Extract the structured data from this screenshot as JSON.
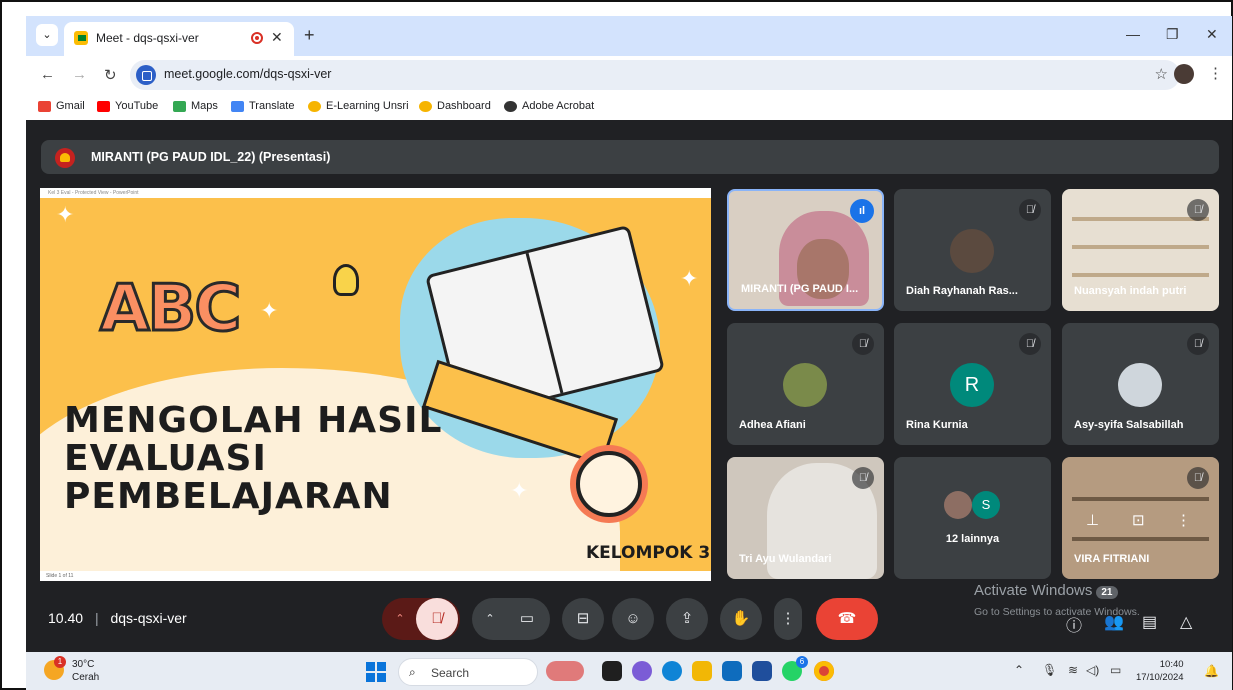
{
  "browser": {
    "tab_title": "Meet - dqs-qsxi-ver",
    "tab_close": "✕",
    "new_tab": "+",
    "url": "meet.google.com/dqs-qsxi-ver",
    "bookmarks": [
      {
        "label": "Gmail",
        "color": "#ea4335"
      },
      {
        "label": "YouTube",
        "color": "#ff0000"
      },
      {
        "label": "Maps",
        "color": "#34a853"
      },
      {
        "label": "Translate",
        "color": "#4285f4"
      },
      {
        "label": "E-Learning Unsri",
        "color": "#f6b400"
      },
      {
        "label": "Dashboard",
        "color": "#f6b400"
      },
      {
        "label": "Adobe Acrobat",
        "color": "#333333"
      }
    ]
  },
  "meet": {
    "presenter_label": "MIRANTI (PG PAUD IDL_22) (Presentasi)",
    "slide": {
      "window_title": "Kel 3 Eval  -  Protected View  -  PowerPoint",
      "logo_text": "ABC",
      "headline_1": "MENGOLAH HASIL",
      "headline_2": "EVALUASI",
      "headline_3": "PEMBELAJARAN",
      "group": "KELOMPOK 3",
      "status": "Slide 1 of 11"
    },
    "tiles": [
      {
        "name": "MIRANTI (PG PAUD I...",
        "kind": "video-speaking"
      },
      {
        "name": "Diah Rayhanah Ras...",
        "kind": "avatar"
      },
      {
        "name": "Nuansyah indah putri",
        "kind": "video-shelf"
      },
      {
        "name": "Adhea Afiani",
        "kind": "avatar"
      },
      {
        "name": "Rina Kurnia",
        "kind": "letter",
        "letter": "R",
        "color": "#00897b"
      },
      {
        "name": "Asy-syifa Salsabillah",
        "kind": "avatar"
      },
      {
        "name": "Tri Ayu Wulandari",
        "kind": "video"
      },
      {
        "name": "12 lainnya",
        "kind": "others",
        "letter": "S"
      },
      {
        "name": "VIRA FITRIANI",
        "kind": "video-shelf"
      }
    ],
    "meeting_time": "10.40",
    "meeting_code": "dqs-qsxi-ver",
    "activate_title": "Activate Windows",
    "activate_sub": "Go to Settings to activate Windows.",
    "participants_count": "21"
  },
  "taskbar": {
    "temp": "30°C",
    "condition": "Cerah",
    "weather_badge": "1",
    "search_placeholder": "Search",
    "time": "10:40",
    "date": "17/10/2024",
    "whatsapp_badge": "6"
  },
  "colors": {
    "accent": "#1a73e8",
    "meet_bg": "#202124",
    "tile_bg": "#3c4043",
    "end_call": "#ea4335"
  }
}
